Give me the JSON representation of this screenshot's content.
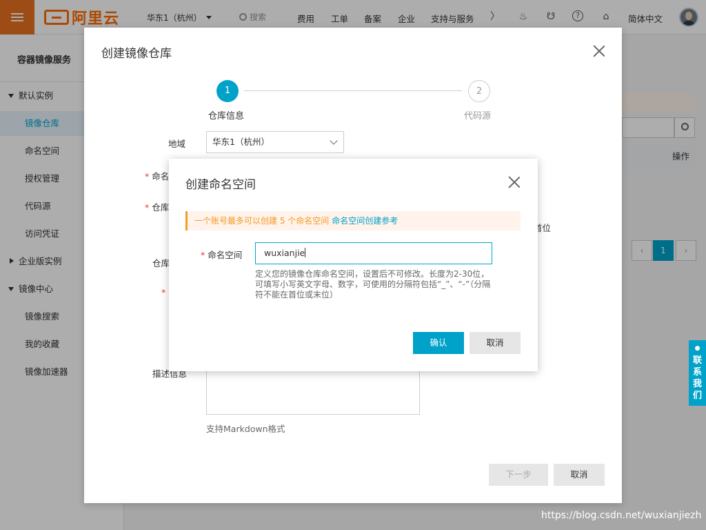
{
  "topbar": {
    "logo_text": "阿里云",
    "region": "华东1（杭州）",
    "search_placeholder": "搜索",
    "nav": [
      "费用",
      "工单",
      "备案",
      "企业",
      "支持与服务"
    ],
    "lang": "简体中文"
  },
  "sidebar": {
    "title": "容器镜像服务",
    "items": [
      {
        "label": "默认实例",
        "kind": "group-open"
      },
      {
        "label": "镜像仓库",
        "kind": "sub",
        "active": true
      },
      {
        "label": "命名空间",
        "kind": "sub"
      },
      {
        "label": "授权管理",
        "kind": "sub"
      },
      {
        "label": "代码源",
        "kind": "sub"
      },
      {
        "label": "访问凭证",
        "kind": "sub"
      },
      {
        "label": "企业版实例",
        "kind": "group-closed"
      },
      {
        "label": "镜像中心",
        "kind": "group-open"
      },
      {
        "label": "镜像搜索",
        "kind": "sub"
      },
      {
        "label": "我的收藏",
        "kind": "sub"
      },
      {
        "label": "镜像加速器",
        "kind": "sub"
      }
    ]
  },
  "background": {
    "table_header_action": "操作",
    "pager_current": "1",
    "partial_text": "首位"
  },
  "repo_dialog": {
    "title": "创建镜像仓库",
    "steps": [
      {
        "number": "1",
        "label": "仓库信息"
      },
      {
        "number": "2",
        "label": "代码源"
      }
    ],
    "region_label": "地域",
    "region_value": "华东1（杭州）",
    "namespace_label": "命名",
    "repo_label": "仓库",
    "repo_type_label": "仓库",
    "desc_label": "描述信息",
    "markdown_note": "支持Markdown格式",
    "next_label": "下一步",
    "cancel_label": "取消"
  },
  "ns_dialog": {
    "title": "创建命名空间",
    "notice_text": "一个账号最多可以创建 5 个命名空间",
    "notice_link": "命名空间创建参考",
    "field_label": "命名空间",
    "field_value": "wuxianjie",
    "hint": "定义您的镜像仓库命名空间，设置后不可修改。长度为2-30位，可填写小写英文字母、数字，可使用的分隔符包括“_”、“-”（分隔符不能在首位或末位）",
    "confirm_label": "确认",
    "cancel_label": "取消"
  },
  "contact_tab": [
    "联",
    "系",
    "我",
    "们"
  ],
  "watermark": "https://blog.csdn.net/wuxianjiezh",
  "colors": {
    "accent": "#00a2ca",
    "brand": "#ff6a00",
    "warning": "#f59a23"
  }
}
